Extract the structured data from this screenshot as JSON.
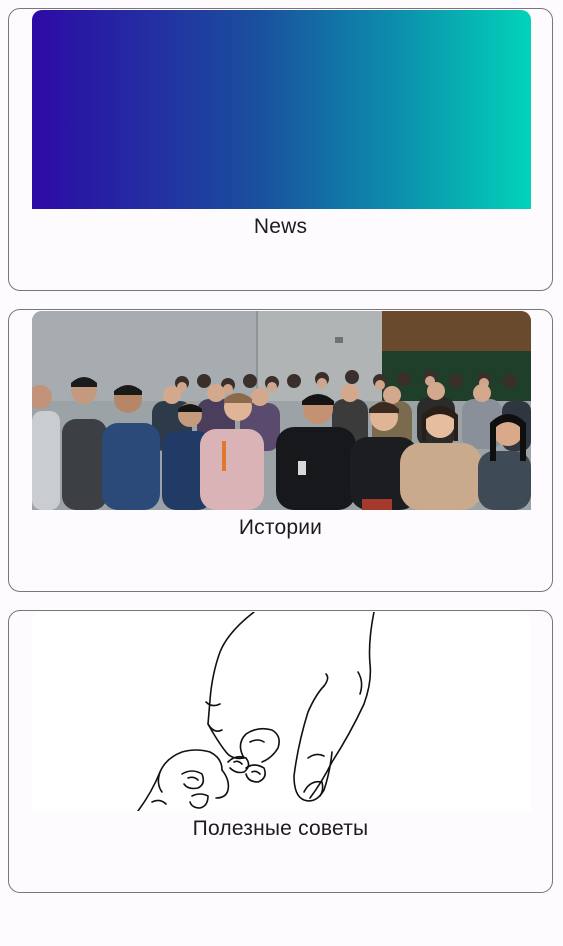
{
  "cards": [
    {
      "title": "News",
      "image": "gradient-banner"
    },
    {
      "title": "Истории",
      "image": "audience-photo"
    },
    {
      "title": "Полезные советы",
      "image": "hands-line-drawing"
    }
  ],
  "colors": {
    "background": "#fefbff",
    "outline": "#79747e",
    "text": "#1c1b1f",
    "gradient_start": "#2d0aa6",
    "gradient_end": "#02d3b9"
  }
}
